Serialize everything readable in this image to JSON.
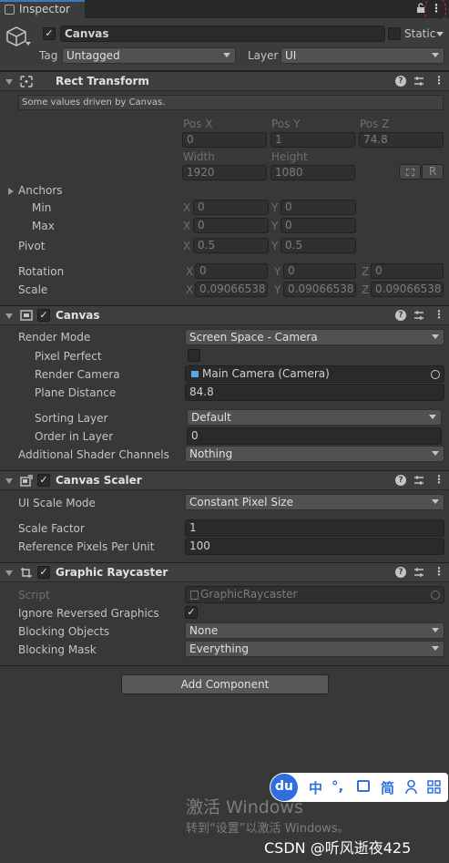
{
  "tab": {
    "label": "Inspector"
  },
  "header": {
    "enabled": true,
    "name": "Canvas",
    "static_label": "Static",
    "tag_label": "Tag",
    "tag_value": "Untagged",
    "layer_label": "Layer",
    "layer_value": "UI"
  },
  "rect_transform": {
    "title": "Rect Transform",
    "info": "Some values driven by Canvas.",
    "pos_x_label": "Pos X",
    "pos_y_label": "Pos Y",
    "pos_z_label": "Pos Z",
    "pos_x": "0",
    "pos_y": "1",
    "pos_z": "74.8",
    "width_label": "Width",
    "height_label": "Height",
    "width": "1920",
    "height": "1080",
    "r_button": "R",
    "anchors_label": "Anchors",
    "min_label": "Min",
    "max_label": "Max",
    "min_x": "0",
    "min_y": "0",
    "max_x": "0",
    "max_y": "0",
    "pivot_label": "Pivot",
    "pivot_x": "0.5",
    "pivot_y": "0.5",
    "rotation_label": "Rotation",
    "rot_x": "0",
    "rot_y": "0",
    "rot_z": "0",
    "scale_label": "Scale",
    "scale_x": "0.09066538",
    "scale_y": "0.09066538",
    "scale_z": "0.09066538",
    "axis_x": "X",
    "axis_y": "Y",
    "axis_z": "Z"
  },
  "canvas": {
    "title": "Canvas",
    "render_mode_label": "Render Mode",
    "render_mode": "Screen Space - Camera",
    "pixel_perfect_label": "Pixel Perfect",
    "render_camera_label": "Render Camera",
    "render_camera": "Main Camera (Camera)",
    "plane_distance_label": "Plane Distance",
    "plane_distance": "84.8",
    "sorting_layer_label": "Sorting Layer",
    "sorting_layer": "Default",
    "order_in_layer_label": "Order in Layer",
    "order_in_layer": "0",
    "shader_channels_label": "Additional Shader Channels",
    "shader_channels": "Nothing"
  },
  "canvas_scaler": {
    "title": "Canvas Scaler",
    "ui_scale_mode_label": "UI Scale Mode",
    "ui_scale_mode": "Constant Pixel Size",
    "scale_factor_label": "Scale Factor",
    "scale_factor": "1",
    "ref_pixels_label": "Reference Pixels Per Unit",
    "ref_pixels": "100"
  },
  "graphic_raycaster": {
    "title": "Graphic Raycaster",
    "script_label": "Script",
    "script": "GraphicRaycaster",
    "ignore_reversed_label": "Ignore Reversed Graphics",
    "blocking_objects_label": "Blocking Objects",
    "blocking_objects": "None",
    "blocking_mask_label": "Blocking Mask",
    "blocking_mask": "Everything"
  },
  "add_component": "Add Component",
  "overlay": {
    "watermark_title": "激活 Windows",
    "watermark_sub": "转到“设置”以激活 Windows。",
    "csdn": "CSDN @听风逝夜425",
    "ime_logo": "du",
    "ime_lang": "中",
    "ime_punct": "°,",
    "ime_simp": "简"
  },
  "colors": {
    "accent": "#3a79bb",
    "panel": "#383838",
    "header": "#3e3e3e",
    "field": "#2a2a2a"
  }
}
